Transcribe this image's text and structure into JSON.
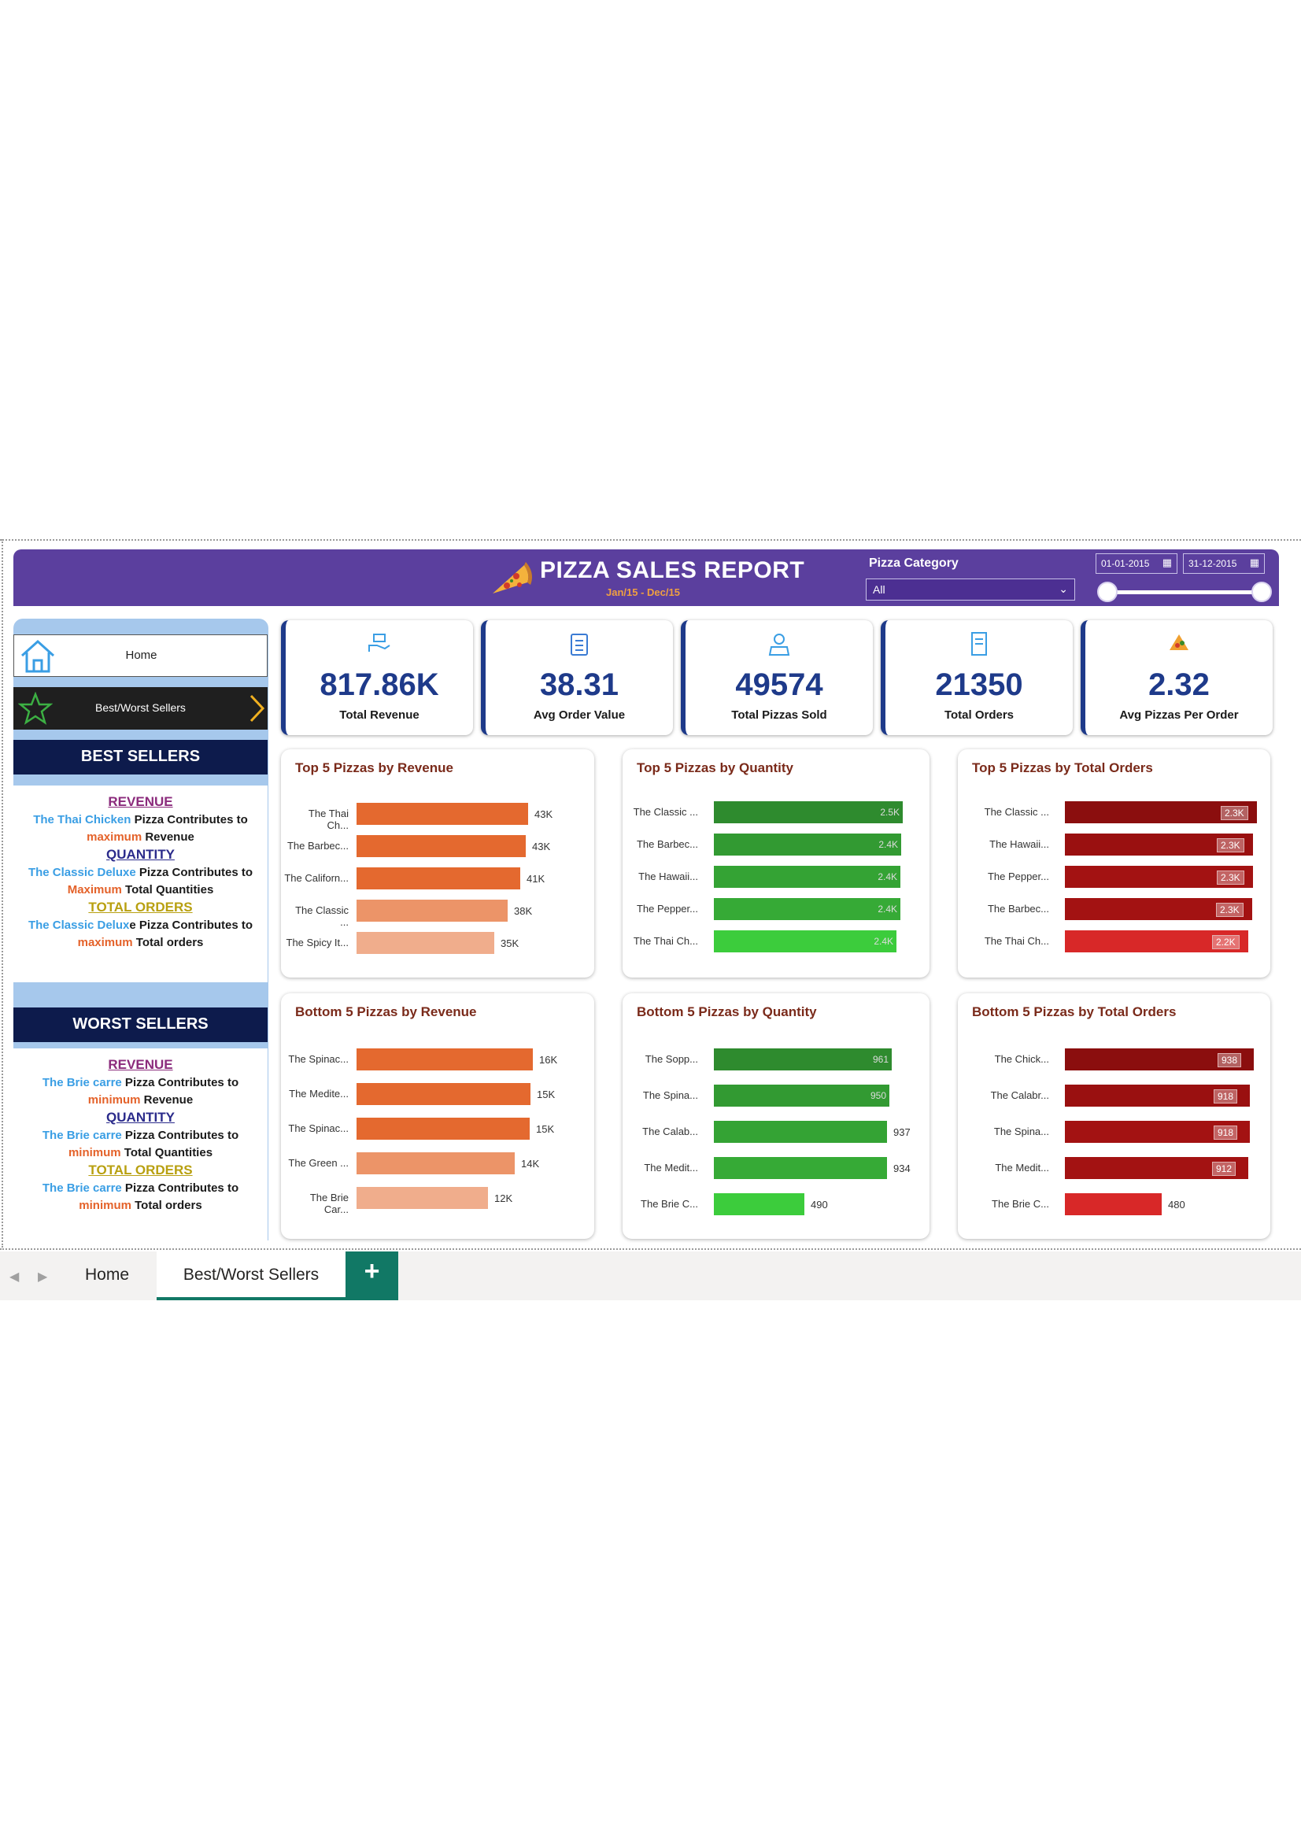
{
  "header": {
    "title": "PIZZA SALES REPORT",
    "subtitle": "Jan/15  -  Dec/15",
    "category_label": "Pizza Category",
    "category_value": "All",
    "date_start": "01-01-2015",
    "date_end": "31-12-2015",
    "colors": {
      "header_bg": "#5b3f9e",
      "accent": "#1e3a8a"
    }
  },
  "nav": {
    "home_label": "Home",
    "best_worst_label": "Best/Worst Sellers"
  },
  "best_sellers": {
    "heading": "BEST SELLERS",
    "revenue_heading": "REVENUE",
    "revenue_name": "The Thai Chicken",
    "revenue_text1": " Pizza Contributes to",
    "revenue_word": "maximum",
    "revenue_text2": " Revenue",
    "quantity_heading": "QUANTITY",
    "quantity_name": "The Classic Deluxe",
    "quantity_text1": " Pizza Contributes to",
    "quantity_word": "Maximum",
    "quantity_text2": " Total Quantities",
    "orders_heading": "TOTAL ORDERS",
    "orders_name": "The Classic Delux",
    "orders_text1": "e Pizza Contributes to",
    "orders_word": "maximum",
    "orders_text2": " Total orders"
  },
  "worst_sellers": {
    "heading": "WORST SELLERS",
    "revenue_heading": "REVENUE",
    "revenue_name": "The Brie carre",
    "revenue_text1": " Pizza Contributes to",
    "revenue_word": "minimum",
    "revenue_text2": " Revenue",
    "quantity_heading": "QUANTITY",
    "quantity_name": "The Brie carre",
    "quantity_text1": " Pizza Contributes to",
    "quantity_word": "minimum",
    "quantity_text2": " Total Quantities",
    "orders_heading": "TOTAL ORDERS",
    "orders_name": "The Brie carre",
    "orders_text1": " Pizza Contributes to",
    "orders_word": "minimum",
    "orders_text2": " Total orders"
  },
  "kpis": [
    {
      "value": "817.86K",
      "label": "Total Revenue",
      "icon": "money-hand-icon"
    },
    {
      "value": "38.31",
      "label": "Avg Order Value",
      "icon": "clipboard-icon"
    },
    {
      "value": "49574",
      "label": "Total Pizzas Sold",
      "icon": "chef-icon"
    },
    {
      "value": "21350",
      "label": "Total Orders",
      "icon": "receipt-icon"
    },
    {
      "value": "2.32",
      "label": "Avg Pizzas Per Order",
      "icon": "pizza-slice-icon"
    }
  ],
  "chart_data": [
    {
      "type": "bar",
      "title": "Top 5 Pizzas by Revenue",
      "categories": [
        "The Thai Ch...",
        "The Barbec...",
        "The Californ...",
        "The Classic ...",
        "The Spicy It..."
      ],
      "values": [
        43434,
        42768,
        41410,
        38180,
        34831
      ],
      "labels": [
        "43K",
        "43K",
        "41K",
        "38K",
        "35K"
      ],
      "colors": [
        "#e4692f",
        "#e4692f",
        "#e4692f",
        "#ec9468",
        "#f0ad8c"
      ],
      "max": 45000,
      "label_mode": "outside"
    },
    {
      "type": "bar",
      "title": "Top 5 Pizzas by Quantity",
      "categories": [
        "The Classic ...",
        "The Barbec...",
        "The Hawaii...",
        "The Pepper...",
        "The Thai Ch..."
      ],
      "values": [
        2453,
        2432,
        2422,
        2418,
        2371
      ],
      "labels": [
        "2.5K",
        "2.4K",
        "2.4K",
        "2.4K",
        "2.4K"
      ],
      "colors": [
        "#2e8b2e",
        "#329a32",
        "#34a334",
        "#36aa36",
        "#3ccc3c"
      ],
      "max": 2453,
      "label_mode": "inside"
    },
    {
      "type": "bar",
      "title": "Top 5 Pizzas by Total Orders",
      "categories": [
        "The Classic ...",
        "The Hawaii...",
        "The Pepper...",
        "The Barbec...",
        "The Thai Ch..."
      ],
      "values": [
        2329,
        2280,
        2278,
        2273,
        2225
      ],
      "labels": [
        "2.3K",
        "2.3K",
        "2.3K",
        "2.3K",
        "2.2K"
      ],
      "colors": [
        "#8b0e0e",
        "#9a1010",
        "#a31212",
        "#a31212",
        "#d82828"
      ],
      "max": 2329,
      "label_mode": "box"
    },
    {
      "type": "bar",
      "title": "Bottom 5 Pizzas by Revenue",
      "categories": [
        "The Spinac...",
        "The Medite...",
        "The Spinac...",
        "The Green ...",
        "The Brie Car..."
      ],
      "values": [
        15596,
        15360,
        15278,
        13956,
        11588
      ],
      "labels": [
        "16K",
        "15K",
        "15K",
        "14K",
        "12K"
      ],
      "colors": [
        "#e4692f",
        "#e4692f",
        "#e4692f",
        "#ec9468",
        "#f0ad8c"
      ],
      "max": 16000,
      "label_mode": "outside"
    },
    {
      "type": "bar",
      "title": "Bottom 5 Pizzas by Quantity",
      "categories": [
        "The Sopp...",
        "The Spina...",
        "The Calab...",
        "The Medit...",
        "The Brie C..."
      ],
      "values": [
        961,
        950,
        937,
        934,
        490
      ],
      "labels": [
        "961",
        "950",
        "937",
        "934",
        "490"
      ],
      "colors": [
        "#2e8b2e",
        "#329a32",
        "#34a334",
        "#36aa36",
        "#3ccc3c"
      ],
      "max": 961,
      "label_mode": "mixed"
    },
    {
      "type": "bar",
      "title": "Bottom 5 Pizzas by Total Orders",
      "categories": [
        "The Chick...",
        "The Calabr...",
        "The Spina...",
        "The Medit...",
        "The Brie C..."
      ],
      "values": [
        938,
        918,
        918,
        912,
        480
      ],
      "labels": [
        "938",
        "918",
        "918",
        "912",
        "480"
      ],
      "colors": [
        "#8b0e0e",
        "#9a1010",
        "#a31212",
        "#a31212",
        "#d82828"
      ],
      "max": 938,
      "label_mode": "box-last-outside"
    }
  ],
  "tabs": {
    "home_label": "Home",
    "best_label": "Best/Worst Sellers",
    "add_label": "+"
  }
}
